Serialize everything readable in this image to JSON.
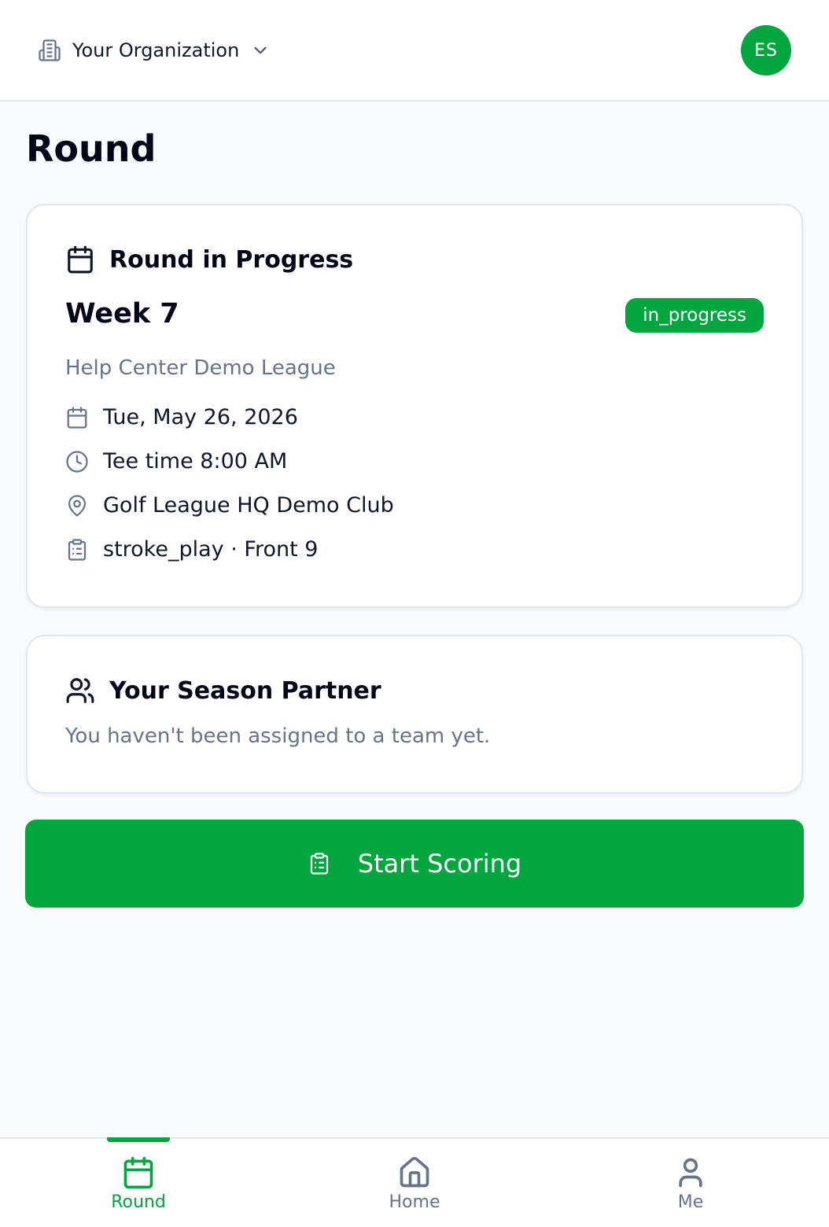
{
  "colors": {
    "accent": "#02a63f",
    "muted_text": "#64748b",
    "border": "#e2e8f0",
    "background": "#f8fafc"
  },
  "header": {
    "org_icon": "building-icon",
    "org_name": "Your Organization",
    "dropdown_icon": "chevron-down-icon",
    "avatar_initials": "ES"
  },
  "page": {
    "title": "Round"
  },
  "round_card": {
    "header_icon": "calendar-icon",
    "title": "Round in Progress",
    "week": "Week 7",
    "status": "in_progress",
    "league": "Help Center Demo League",
    "details": [
      {
        "icon": "calendar-icon",
        "text": "Tue, May 26, 2026"
      },
      {
        "icon": "clock-icon",
        "text": "Tee time 8:00 AM"
      },
      {
        "icon": "map-pin-icon",
        "text": "Golf League HQ Demo Club"
      },
      {
        "icon": "clipboard-list-icon",
        "text": "stroke_play · Front 9"
      }
    ]
  },
  "partner_card": {
    "header_icon": "users-icon",
    "title": "Your Season Partner",
    "message": "You haven't been assigned to a team yet."
  },
  "actions": {
    "start_scoring_icon": "clipboard-list-icon",
    "start_scoring_label": "Start Scoring"
  },
  "bottom_nav": {
    "active": "Round",
    "items": [
      {
        "icon": "calendar-icon",
        "label": "Round"
      },
      {
        "icon": "home-icon",
        "label": "Home"
      },
      {
        "icon": "user-icon",
        "label": "Me"
      }
    ]
  }
}
